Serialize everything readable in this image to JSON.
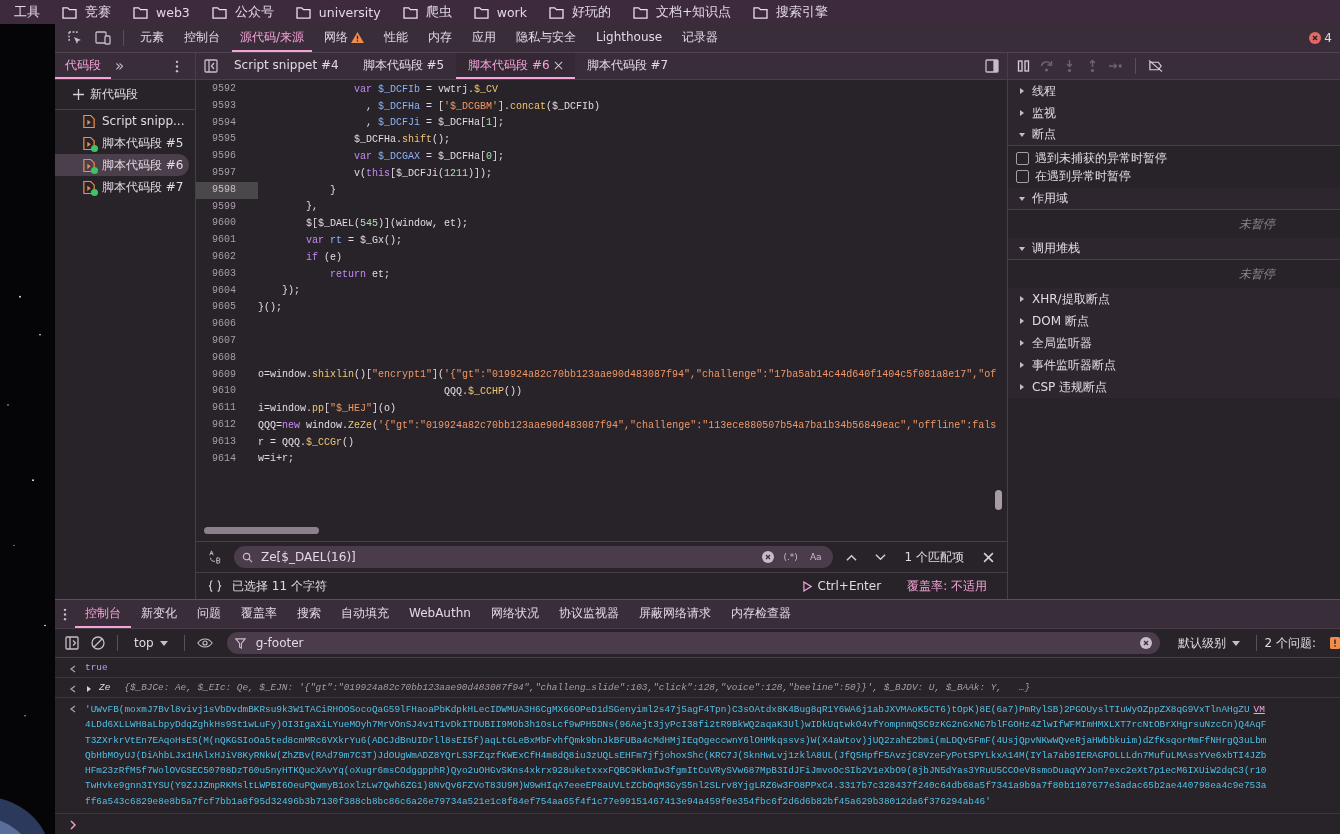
{
  "bookmarks": [
    {
      "label": "工具",
      "icon": false
    },
    {
      "label": "竞赛",
      "icon": true
    },
    {
      "label": "web3",
      "icon": true
    },
    {
      "label": "公众号",
      "icon": true
    },
    {
      "label": "university",
      "icon": true
    },
    {
      "label": "爬虫",
      "icon": true
    },
    {
      "label": "work",
      "icon": true
    },
    {
      "label": "好玩的",
      "icon": true
    },
    {
      "label": "文档+知识点",
      "icon": true
    },
    {
      "label": "搜索引擎",
      "icon": true
    }
  ],
  "panel_tabs": [
    {
      "label": "元素",
      "selected": false,
      "warning": false
    },
    {
      "label": "控制台",
      "selected": false,
      "warning": false
    },
    {
      "label": "源代码/来源",
      "selected": true,
      "warning": false
    },
    {
      "label": "网络",
      "selected": false,
      "warning": true
    },
    {
      "label": "性能",
      "selected": false,
      "warning": false
    },
    {
      "label": "内存",
      "selected": false,
      "warning": false
    },
    {
      "label": "应用",
      "selected": false,
      "warning": false
    },
    {
      "label": "隐私与安全",
      "selected": false,
      "warning": false
    },
    {
      "label": "Lighthouse",
      "selected": false,
      "warning": false
    },
    {
      "label": "记录器",
      "selected": false,
      "warning": false
    }
  ],
  "error_count": "4",
  "navigator": {
    "tab": "代码段",
    "more": "»",
    "new_snippet": "新代码段",
    "items": [
      {
        "label": "Script snipp...",
        "selected": false,
        "dot": false
      },
      {
        "label": "脚本代码段 #5",
        "selected": false,
        "dot": true
      },
      {
        "label": "脚本代码段 #6",
        "selected": true,
        "dot": true
      },
      {
        "label": "脚本代码段 #7",
        "selected": false,
        "dot": true
      }
    ]
  },
  "editor_tabs": [
    {
      "label": "Script snippet #4",
      "selected": false
    },
    {
      "label": "脚本代码段 #5",
      "selected": false
    },
    {
      "label": "脚本代码段 #6",
      "selected": true
    },
    {
      "label": "脚本代码段 #7",
      "selected": false
    }
  ],
  "code_lines": [
    {
      "number": "9592",
      "current": false,
      "tokens": [
        {
          "kind": "kw",
          "text": "                var "
        },
        {
          "kind": "def",
          "text": "$_DCFIb"
        },
        {
          "kind": "plain",
          "text": " = vwtrj."
        },
        {
          "kind": "prop",
          "text": "$_CV"
        }
      ]
    },
    {
      "number": "9593",
      "current": false,
      "tokens": [
        {
          "kind": "plain",
          "text": "                  , "
        },
        {
          "kind": "def",
          "text": "$_DCFHa"
        },
        {
          "kind": "plain",
          "text": " = ["
        },
        {
          "kind": "str",
          "text": "'$_DCGBM'"
        },
        {
          "kind": "plain",
          "text": "]."
        },
        {
          "kind": "prop",
          "text": "concat"
        },
        {
          "kind": "plain",
          "text": "($_DCFIb)"
        }
      ]
    },
    {
      "number": "9594",
      "current": false,
      "tokens": [
        {
          "kind": "plain",
          "text": "                  , "
        },
        {
          "kind": "def",
          "text": "$_DCFJi"
        },
        {
          "kind": "plain",
          "text": " = $_DCFHa["
        },
        {
          "kind": "num",
          "text": "1"
        },
        {
          "kind": "plain",
          "text": "];"
        }
      ]
    },
    {
      "number": "9595",
      "current": false,
      "tokens": [
        {
          "kind": "plain",
          "text": "                $_DCFHa."
        },
        {
          "kind": "prop",
          "text": "shift"
        },
        {
          "kind": "plain",
          "text": "();"
        }
      ]
    },
    {
      "number": "9596",
      "current": false,
      "tokens": [
        {
          "kind": "kw",
          "text": "                var "
        },
        {
          "kind": "def",
          "text": "$_DCGAX"
        },
        {
          "kind": "plain",
          "text": " = $_DCFHa["
        },
        {
          "kind": "num",
          "text": "0"
        },
        {
          "kind": "plain",
          "text": "];"
        }
      ]
    },
    {
      "number": "9597",
      "current": false,
      "tokens": [
        {
          "kind": "plain",
          "text": "                v("
        },
        {
          "kind": "kw",
          "text": "this"
        },
        {
          "kind": "plain",
          "text": "[$_DCFJi("
        },
        {
          "kind": "num",
          "text": "1211"
        },
        {
          "kind": "plain",
          "text": ")]);"
        }
      ]
    },
    {
      "number": "9598",
      "current": true,
      "tokens": [
        {
          "kind": "plain",
          "text": "            }"
        }
      ]
    },
    {
      "number": "9599",
      "current": false,
      "tokens": [
        {
          "kind": "plain",
          "text": "        },"
        }
      ]
    },
    {
      "number": "9600",
      "current": false,
      "tokens": [
        {
          "kind": "plain",
          "text": "        $[$_DAEL("
        },
        {
          "kind": "num",
          "text": "545"
        },
        {
          "kind": "plain",
          "text": ")](window, et);"
        }
      ]
    },
    {
      "number": "9601",
      "current": false,
      "tokens": [
        {
          "kind": "kw",
          "text": "        var "
        },
        {
          "kind": "def",
          "text": "rt"
        },
        {
          "kind": "plain",
          "text": " = $_Gx();"
        }
      ]
    },
    {
      "number": "9602",
      "current": false,
      "tokens": [
        {
          "kind": "kw",
          "text": "        if"
        },
        {
          "kind": "plain",
          "text": " (e)"
        }
      ]
    },
    {
      "number": "9603",
      "current": false,
      "tokens": [
        {
          "kind": "kw",
          "text": "            return"
        },
        {
          "kind": "plain",
          "text": " et;"
        }
      ]
    },
    {
      "number": "9604",
      "current": false,
      "tokens": [
        {
          "kind": "plain",
          "text": "    });"
        }
      ]
    },
    {
      "number": "9605",
      "current": false,
      "tokens": [
        {
          "kind": "plain",
          "text": "}();"
        }
      ]
    },
    {
      "number": "9606",
      "current": false
    },
    {
      "number": "9607",
      "current": false
    },
    {
      "number": "9608",
      "current": false
    },
    {
      "number": "9609",
      "current": false,
      "tokens": [
        {
          "kind": "plain",
          "text": "o=window."
        },
        {
          "kind": "prop",
          "text": "shixlin"
        },
        {
          "kind": "plain",
          "text": "()["
        },
        {
          "kind": "str",
          "text": "\"encrypt1\""
        },
        {
          "kind": "plain",
          "text": "]("
        },
        {
          "kind": "str",
          "text": "'{\"gt\":\"019924a82c70bb123aae90d483087f94\",\"challenge\":\"17ba5ab14c44d640f1404c5f081a8e17\",\"of"
        }
      ]
    },
    {
      "number": "9610",
      "current": false,
      "tokens": [
        {
          "kind": "plain",
          "text": "                               QQQ."
        },
        {
          "kind": "prop",
          "text": "$_CCHP"
        },
        {
          "kind": "plain",
          "text": "())"
        }
      ]
    },
    {
      "number": "9611",
      "current": false,
      "tokens": [
        {
          "kind": "plain",
          "text": "i=window."
        },
        {
          "kind": "prop",
          "text": "pp"
        },
        {
          "kind": "plain",
          "text": "["
        },
        {
          "kind": "str",
          "text": "\"$_HEJ\""
        },
        {
          "kind": "plain",
          "text": "](o)"
        }
      ]
    },
    {
      "number": "9612",
      "current": false,
      "tokens": [
        {
          "kind": "plain",
          "text": "QQQ="
        },
        {
          "kind": "kw",
          "text": "new"
        },
        {
          "kind": "plain",
          "text": " window."
        },
        {
          "kind": "prop",
          "text": "ZeZe"
        },
        {
          "kind": "plain",
          "text": "("
        },
        {
          "kind": "str",
          "text": "'{\"gt\":\"019924a82c70bb123aae90d483087f94\",\"challenge\":\"113ece880507b54a7ba1b34b56849eac\",\"offline\":fals"
        }
      ]
    },
    {
      "number": "9613",
      "current": false,
      "tokens": [
        {
          "kind": "plain",
          "text": "r = QQQ."
        },
        {
          "kind": "prop",
          "text": "$_CCGr"
        },
        {
          "kind": "plain",
          "text": "()"
        }
      ]
    },
    {
      "number": "9614",
      "current": false,
      "tokens": [
        {
          "kind": "plain",
          "text": "w=i+r;"
        }
      ]
    }
  ],
  "search": {
    "value": "Ze[$_DAEL(16)]",
    "regex": "(.*)",
    "case": "Aa",
    "matches": "1 个匹配项"
  },
  "status_bar": {
    "selection": "已选择 11 个字符",
    "run": "Ctrl+Enter",
    "coverage": "覆盖率: 不适用"
  },
  "debugger": {
    "sections": [
      {
        "title": "线程",
        "expanded": false
      },
      {
        "title": "监视",
        "expanded": false
      },
      {
        "title": "断点",
        "expanded": true,
        "kind": "checkboxes",
        "items": [
          {
            "label": "遇到未捕获的异常时暂停",
            "checked": false
          },
          {
            "label": "在遇到异常时暂停",
            "checked": false
          }
        ]
      },
      {
        "title": "作用域",
        "expanded": true,
        "kind": "note",
        "note": "未暂停"
      },
      {
        "title": "调用堆栈",
        "expanded": true,
        "kind": "note",
        "note": "未暂停"
      },
      {
        "title": "XHR/提取断点",
        "expanded": false
      },
      {
        "title": "DOM 断点",
        "expanded": false
      },
      {
        "title": "全局监听器",
        "expanded": false
      },
      {
        "title": "事件监听器断点",
        "expanded": false
      },
      {
        "title": "CSP 违规断点",
        "expanded": false
      }
    ]
  },
  "drawer_tabs": [
    {
      "label": "控制台",
      "selected": true
    },
    {
      "label": "新变化",
      "selected": false
    },
    {
      "label": "问题",
      "selected": false
    },
    {
      "label": "覆盖率",
      "selected": false
    },
    {
      "label": "搜索",
      "selected": false
    },
    {
      "label": "自动填充",
      "selected": false
    },
    {
      "label": "WebAuthn",
      "selected": false
    },
    {
      "label": "网络状况",
      "selected": false
    },
    {
      "label": "协议监视器",
      "selected": false
    },
    {
      "label": "屏蔽网络请求",
      "selected": false
    },
    {
      "label": "内存检查器",
      "selected": false
    }
  ],
  "console_toolbar": {
    "context": "top",
    "filter": "g-footer",
    "level": "默认级别",
    "issues": "2 个问题:"
  },
  "console_messages": [
    {
      "kind": "value",
      "text": "true"
    },
    {
      "kind": "object",
      "name": "Ze",
      "text": "{$_BJCe: Ae, $_EIc: Qe, $_EJN: '{\"gt\":\"019924a82c70bb123aae90d483087f94\",\"challeng…slide\":103,\"click\":128,\"voice\":128,\"beeline\":50}}', $_BJDV: U, $_BAAk: Y,   …}"
    },
    {
      "kind": "string",
      "link": "VM",
      "lines": [
        "'UWvFB(moxmJ7Bvl8vivj1sVbDvdmBKRsu9k3W1TACiRHOOSocoQaG59lFHaoaPbKdpkHLecIDWMUA3H6CgMX66OPeD1dSGenyiml2s47j5agF4Tpn)C3sOAtdx8K4Bug8qR1Y6WA6j1abJXVMAoK5CT6)tOpK)8E(6a7)PmRylSB)2PGOUyslTIuWyOZppZX8qG9VxTlnAHgZU",
        "4LDd6XLLWH8aLbpyDdqZghkHs9St1wLuFy)OI3IgaXiLYueMOyh7MrVOnSJ4v1T1vDkITDUBII9MOb3h1OsLcf9wPH5DNs(96Aejt3jyPcI38fi2tR9BkWQ2aqaK3Ul)wIDkUqtwkO4vfYompnmQSC9zKG2nGxNG7blFGOHz4ZlwIfWFMImHMXLXT7rcNtOBrXHgrsuNzcCn)Q4AqF",
        "T3ZXrkrVtEn7EAqoHsES(M(nQKGSIoOa5ted8cmMRc6VXkrYu6(ADCJdBnUIDrll8sEI5f)aqLtGLeBxMbFvhfQmk9bnJkBFUBa4cMdHMjIEqOgeccwnY6lOHMkqssvs)W(X4aWtov)jUQ2zahE2bmi(mLDQv5FmF(4UsjQpvNKwWQveRjaHWbbkuim)dZfKsqorMmFfNHrgQ3uLbm",
        "QbHbMOyUJ(DiAhbLJx1HAlxHJiV8KyRNkW(ZhZBv(RAd79m7C3T)JdOUgWmADZ8YQrLS3FZqzfKWExCfH4m8dQ8iu3zUQLsEHFm7jfjohoxShc(KRC7J(SknHwLvj1zklA8UL(JfQ5HpfF5AvzjC8VzeFyPotSPYLkxA14M(IYla7ab9IERAGPOLLLdn7MufuLMAssYVe6xbTI4JZb",
        "HFm23zRfM5f7WolOVGSEC50708DzT60u5nyHTKQucXAvYq(oXugr6msCOdggpphR)Qyo2uOHGvSKns4xkrx928uketxxxFQBC9KkmIw3fgmItCuVRySVw687MpB3IdJFiJmvoOcSIb2V1eXbO9(8jbJN5dYas3YRuU5CCOeV8smoDuaqVYJon7exc2eXt7p1ecM6IXUiW2dqC3(r10",
        "TwHvke9gnn3IYSU(Y9ZJJZmpRKMsltLWPBI6OeuPQwmyB1oxlzLw7Qwh6ZG1)8NvQv6FZVoT83U9M)W9wHIqA7eeeEP8aUVLtZCbOqM3GyS5nl2SLrv8YjgLRZ6w3FO8PPxC4.3317b7c328437f240c64db68a5f7341a9b9a7f80b1107677e3adac65b2ae440798ea4c9e753a",
        "ff6a543c6829e8e8b5a7fcf7bb1a8f95d32496b3b7130f388cb8bc86c6a26e79734a521e1c8f84ef754aa65f4f1c77e99151467413e94a459f0e354fbc6f2d6d6b82bf45a629b38012da6f376294ab46'"
      ]
    }
  ]
}
